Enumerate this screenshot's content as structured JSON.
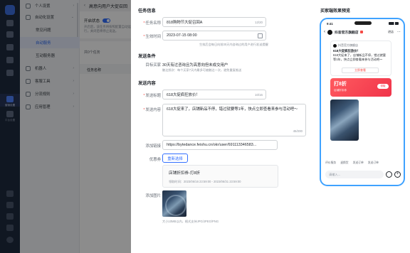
{
  "rail": {
    "items": [
      {
        "label": ""
      },
      {
        "label": ""
      },
      {
        "label": ""
      },
      {
        "label": ""
      },
      {
        "label": ""
      },
      {
        "label": "营销设置"
      },
      {
        "label": "平台设置"
      }
    ]
  },
  "menu": {
    "items": [
      {
        "label": "个人设置"
      },
      {
        "label": "自动化设置"
      },
      {
        "label": "常见问题"
      },
      {
        "label": "自动服务"
      },
      {
        "label": "互动服务器"
      },
      {
        "label": "机器人"
      },
      {
        "label": "客服工具"
      },
      {
        "label": "分流规则"
      },
      {
        "label": "应用管理"
      }
    ]
  },
  "page": {
    "breadcrumb": "高意向用户大促召回",
    "switch_label": "开启状态",
    "switch_desc": "开启后，该任务将按照配置自动运行，关闭后将停止发送。",
    "count": "共0个任务",
    "col_name": "任务名称"
  },
  "form": {
    "sec_task": "任务信息",
    "name_label": "任务名称",
    "name_value": "818购物节大促召回A",
    "name_count": "12/20",
    "time_label": "生效时间",
    "time_value": "2023-07-15 08:00",
    "time_hint": "生效后会每日向前30天内咨询过的用户进行发送提醒",
    "sec_cond": "发送条件",
    "target_label": "目标买家",
    "target_value": "30天有过咨询且为高意向但未成交用户",
    "target_hint": "触达频次：每个买家7天内最多可被触达一次，避免重复推送",
    "sec_content": "发送内容",
    "title_label": "发送标题",
    "title_value": "618大促疯狂放价！",
    "title_count": "10/16",
    "content_label": "发送内容",
    "content_value": "618大促来了，店铺新品不停，错过就要等1年，快点立即查看来参与活动吧～",
    "content_count": "45/200",
    "link_label": "添加链接",
    "link_value": "https://bytedance.feishu.cn/okr/user/691113346583...",
    "coupon_label": "优惠券",
    "reselect_label": "重新选择",
    "coupon_title": "店铺折扣券-打8折",
    "coupon_date": "领取时间：2023/06/16 23:59:00 - 2023/06/31 23:59:00",
    "image_label": "添加图片",
    "image_hint": "大小10MB以内，格式支持JPG/JPEG/PNG"
  },
  "preview": {
    "title": "买家端效果预览",
    "time": "9:41",
    "shop": "抖音官方旗舰店",
    "enter": "进店",
    "card_shop": "抖音官方旗舰店",
    "card_title": "618大促疯狂放价！",
    "card_body": "618大促来了，店铺新品不停，错过就要等1年，快点立即查看来参与活动吧～",
    "card_button": "立即查看",
    "coupon_big": "打8折",
    "coupon_small": "店铺折扣券",
    "coupon_go": "领取",
    "tools": [
      "评价服务",
      "退换货",
      "发送订单",
      "发送订单"
    ],
    "input_placeholder": "请输入..."
  },
  "colors": {
    "accent": "#3370ff",
    "preview_border": "#3fa2ff",
    "coupon_red": "#f0344a"
  }
}
